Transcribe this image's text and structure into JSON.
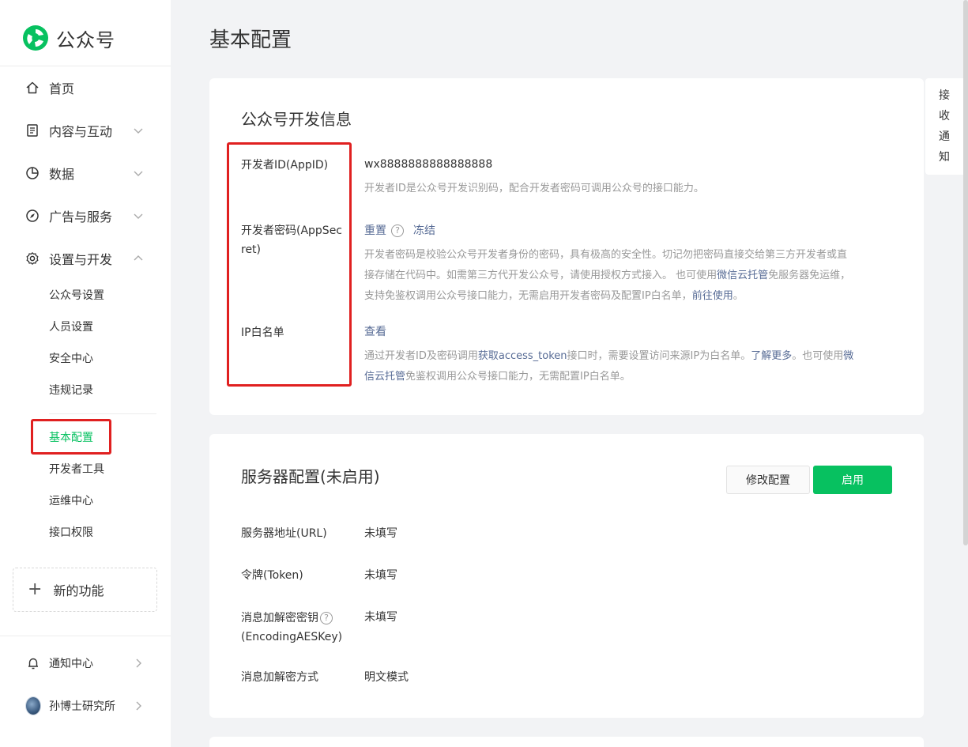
{
  "brand": {
    "name": "公众号"
  },
  "nav": {
    "home": "首页",
    "content": "内容与互动",
    "data": "数据",
    "ads": "广告与服务",
    "settings": "设置与开发"
  },
  "sub_nav": {
    "account_settings": "公众号设置",
    "people_settings": "人员设置",
    "security_center": "安全中心",
    "violations": "违规记录",
    "basic_config": "基本配置",
    "dev_tools": "开发者工具",
    "ops_center": "运维中心",
    "api_permissions": "接口权限"
  },
  "new_feature": "新的功能",
  "bottom": {
    "notifications": "通知中心",
    "account": "孙博士研究所"
  },
  "page_title": "基本配置",
  "float_notice": [
    "接",
    "收",
    "通",
    "知"
  ],
  "dev_info": {
    "title": "公众号开发信息",
    "appid_label": "开发者ID(AppID)",
    "appid_value": "wx8888888888888888",
    "appid_desc": "开发者ID是公众号开发识别码，配合开发者密码可调用公众号的接口能力。",
    "secret_label_1": "开发者密码(AppSec",
    "secret_label_2": "ret)",
    "reset": "重置",
    "help_mark": "?",
    "freeze": "冻结",
    "secret_desc_1": "开发者密码是校验公众号开发者身份的密码，具有极高的安全性。切记勿把密码直接交给第三方开发者或直",
    "secret_desc_2a": "接存储在代码中。如需第三方代开发公众号，请使用授权方式接入。 也可使用",
    "secret_desc_2link": "微信云托管",
    "secret_desc_2b": "免服务器免运维，",
    "secret_desc_3a": "支持免鉴权调用公众号接口能力，无需启用开发者密码及配置IP白名单，",
    "secret_desc_3link": "前往使用",
    "secret_desc_3b": "。",
    "ip_label": "IP白名单",
    "ip_view": "查看",
    "ip_desc_1a": "通过开发者ID及密码调用",
    "ip_desc_1link": "获取access_token",
    "ip_desc_1b": "接口时，需要设置访问来源IP为白名单。",
    "ip_desc_1link2": "了解更多",
    "ip_desc_1c": "。也可使用",
    "ip_desc_1link3": "微",
    "ip_desc_2link": "信云托管",
    "ip_desc_2b": "免鉴权调用公众号接口能力，无需配置IP白名单。"
  },
  "server_config": {
    "title": "服务器配置(未启用)",
    "modify_button": "修改配置",
    "enable_button": "启用",
    "url_label": "服务器地址(URL)",
    "url_value": "未填写",
    "token_label": "令牌(Token)",
    "token_value": "未填写",
    "aes_label_1": "消息加解密密钥",
    "aes_help": "?",
    "aes_label_2": "(EncodingAESKey)",
    "aes_value": "未填写",
    "mode_label": "消息加解密方式",
    "mode_value": "明文模式"
  }
}
